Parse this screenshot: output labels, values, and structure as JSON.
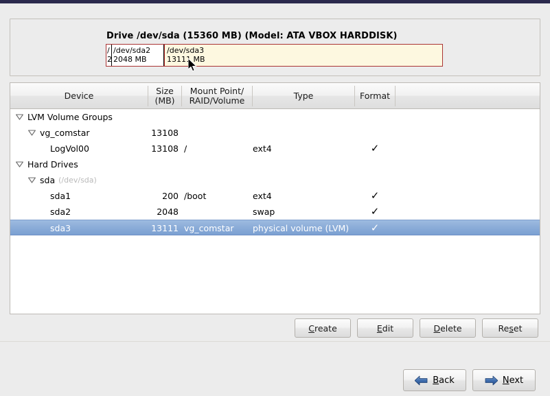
{
  "drive": {
    "title": "Drive /dev/sda (15360 MB) (Model: ATA VBOX HARDDISK)",
    "segments": [
      {
        "name": "/",
        "size": "2",
        "selected": false
      },
      {
        "name": "/dev/sda2",
        "size": "2048 MB",
        "selected": false
      },
      {
        "name": "/dev/sda3",
        "size": "13111 MB",
        "selected": true
      }
    ]
  },
  "table": {
    "columns": [
      {
        "id": "device",
        "label": "Device"
      },
      {
        "id": "size",
        "label": "Size\n(MB)",
        "line1": "Size",
        "line2": "(MB)"
      },
      {
        "id": "mount",
        "label": "Mount Point/\nRAID/Volume",
        "line1": "Mount Point/",
        "line2": "RAID/Volume"
      },
      {
        "id": "type",
        "label": "Type"
      },
      {
        "id": "format",
        "label": "Format"
      }
    ],
    "rows": [
      {
        "device": "LVM Volume Groups",
        "suffix": "",
        "size": "",
        "mount": "",
        "type": "",
        "format": "",
        "indent": 0,
        "expander": "expanded",
        "selected": false
      },
      {
        "device": "vg_comstar",
        "suffix": "",
        "size": "13108",
        "mount": "",
        "type": "",
        "format": "",
        "indent": 1,
        "expander": "expanded",
        "selected": false
      },
      {
        "device": "LogVol00",
        "suffix": "",
        "size": "13108",
        "mount": "/",
        "type": "ext4",
        "format": "✓",
        "indent": 2,
        "expander": "none",
        "selected": false
      },
      {
        "device": "Hard Drives",
        "suffix": "",
        "size": "",
        "mount": "",
        "type": "",
        "format": "",
        "indent": 0,
        "expander": "expanded",
        "selected": false
      },
      {
        "device": "sda",
        "suffix": "(/dev/sda)",
        "size": "",
        "mount": "",
        "type": "",
        "format": "",
        "indent": 1,
        "expander": "expanded",
        "selected": false
      },
      {
        "device": "sda1",
        "suffix": "",
        "size": "200",
        "mount": "/boot",
        "type": "ext4",
        "format": "✓",
        "indent": 2,
        "expander": "none",
        "selected": false
      },
      {
        "device": "sda2",
        "suffix": "",
        "size": "2048",
        "mount": "",
        "type": "swap",
        "format": "✓",
        "indent": 2,
        "expander": "none",
        "selected": false
      },
      {
        "device": "sda3",
        "suffix": "",
        "size": "13111",
        "mount": "vg_comstar",
        "type": "physical volume (LVM)",
        "format": "✓",
        "indent": 2,
        "expander": "none",
        "selected": true
      }
    ]
  },
  "actions": {
    "create": {
      "pre": "",
      "mnemonic": "C",
      "post": "reate"
    },
    "edit": {
      "pre": "",
      "mnemonic": "E",
      "post": "dit"
    },
    "delete": {
      "pre": "",
      "mnemonic": "D",
      "post": "elete"
    },
    "reset": {
      "pre": "Re",
      "mnemonic": "s",
      "post": "et"
    }
  },
  "nav": {
    "back": {
      "pre": "",
      "mnemonic": "B",
      "post": "ack",
      "icon": "arrow-left-icon"
    },
    "next": {
      "pre": "",
      "mnemonic": "N",
      "post": "ext",
      "icon": "arrow-right-icon"
    }
  },
  "colors": {
    "selection": "#8bacd8",
    "drive_bar_border": "#aa3333",
    "drive_bar_selected_fill": "#fdf8e0",
    "arrow_blue": "#2e5fa3",
    "top_strip": "#2b2a4d"
  }
}
